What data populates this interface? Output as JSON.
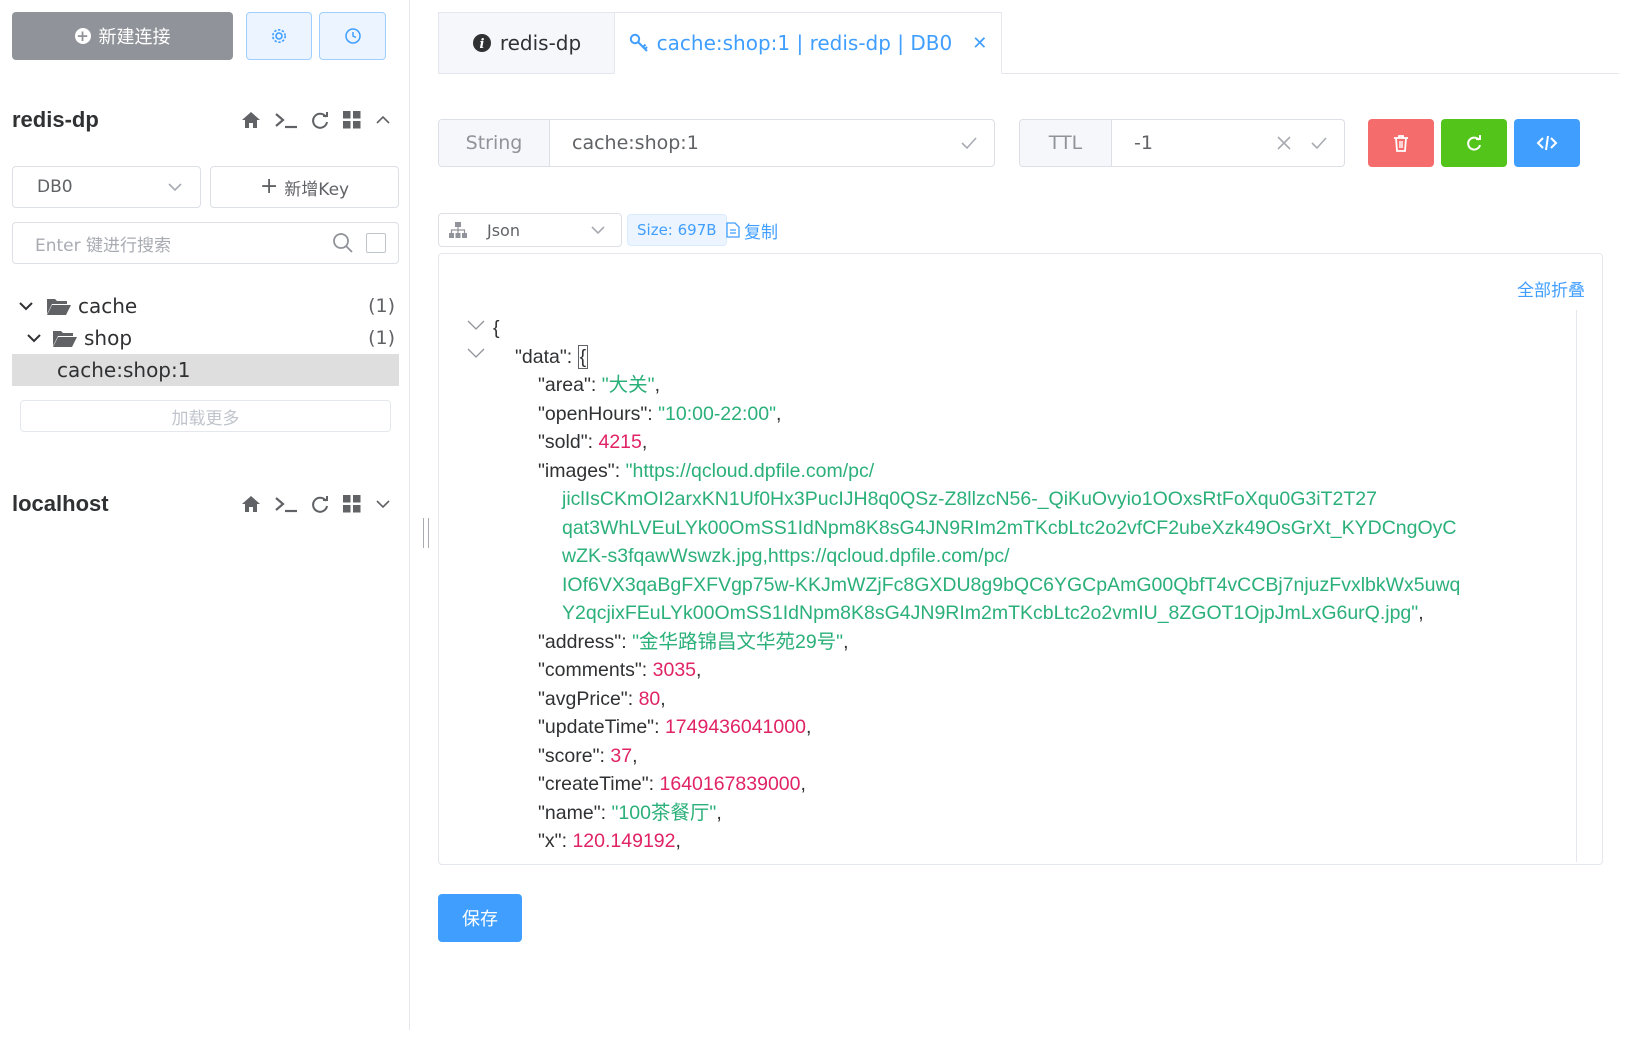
{
  "toolbar": {
    "new_connection_label": "新建连接",
    "settings_icon": "gear-icon",
    "history_icon": "clock-icon"
  },
  "connections": [
    {
      "name": "redis-dp",
      "expanded": true
    },
    {
      "name": "localhost",
      "expanded": false
    }
  ],
  "db_select": {
    "value": "DB0"
  },
  "add_key_label": "新增Key",
  "search": {
    "placeholder": "Enter 键进行搜索"
  },
  "tree": [
    {
      "label": "cache",
      "count": "(1)"
    },
    {
      "label": "shop",
      "count": "(1)"
    },
    {
      "label": "cache:shop:1"
    }
  ],
  "load_more_label": "加载更多",
  "tabs": [
    {
      "label": "redis-dp"
    },
    {
      "label": "cache:shop:1 | redis-dp | DB0"
    }
  ],
  "key": {
    "type": "String",
    "name": "cache:shop:1",
    "ttl_label": "TTL",
    "ttl_value": "-1"
  },
  "actions": {
    "delete_color": "#f56c6c",
    "refresh_color": "#52c41a",
    "code_color": "#409eff"
  },
  "viewer": {
    "format": "Json",
    "size": "Size: 697B",
    "copy_label": "复制",
    "collapse_all_label": "全部折叠"
  },
  "json_lines": {
    "l0": "{",
    "l1_key": "\"data\"",
    "l1_brace": "{",
    "area_key": "\"area\"",
    "area_val": "\"大关\"",
    "openHours_key": "\"openHours\"",
    "openHours_val": "\"10:00-22:00\"",
    "sold_key": "\"sold\"",
    "sold_val": "4215",
    "images_key": "\"images\"",
    "images_val_1": "\"https://qcloud.dpfile.com/pc/",
    "images_val_2": "jiclIsCKmOI2arxKN1Uf0Hx3PucIJH8q0QSz-Z8llzcN56-_QiKuOvyio1OOxsRtFoXqu0G3iT2T27",
    "images_val_3": "qat3WhLVEuLYk00OmSS1IdNpm8K8sG4JN9RIm2mTKcbLtc2o2vfCF2ubeXzk49OsGrXt_KYDCngOyC",
    "images_val_4": "wZK-s3fqawWswzk.jpg,https://qcloud.dpfile.com/pc/",
    "images_val_5": "IOf6VX3qaBgFXFVgp75w-KKJmWZjFc8GXDU8g9bQC6YGCpAmG00QbfT4vCCBj7njuzFvxlbkWx5uwq",
    "images_val_6": "Y2qcjixFEuLYk00OmSS1IdNpm8K8sG4JN9RIm2mTKcbLtc2o2vmIU_8ZGOT1OjpJmLxG6urQ.jpg\"",
    "address_key": "\"address\"",
    "address_val": "\"金华路锦昌文华苑29号\"",
    "comments_key": "\"comments\"",
    "comments_val": "3035",
    "avgPrice_key": "\"avgPrice\"",
    "avgPrice_val": "80",
    "updateTime_key": "\"updateTime\"",
    "updateTime_val": "1749436041000",
    "score_key": "\"score\"",
    "score_val": "37",
    "createTime_key": "\"createTime\"",
    "createTime_val": "1640167839000",
    "name_key": "\"name\"",
    "name_val": "\"100茶餐厅\"",
    "x_key": "\"x\"",
    "x_val": "120.149192"
  },
  "save_label": "保存"
}
